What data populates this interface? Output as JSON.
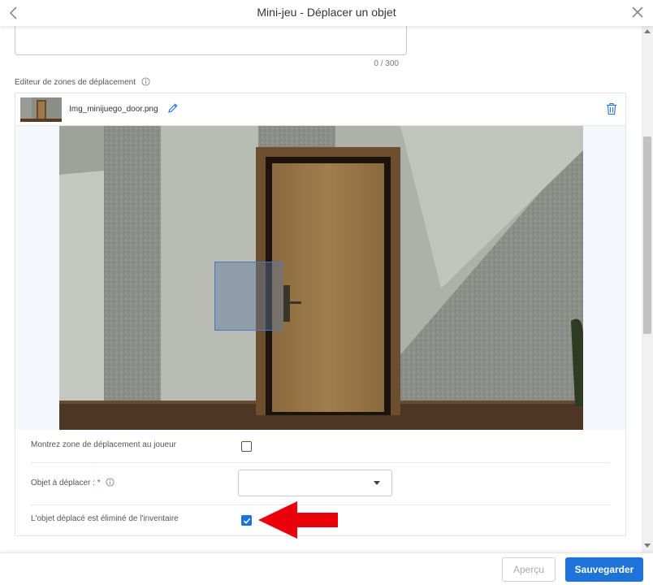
{
  "header": {
    "title": "Mini-jeu - Déplacer un objet",
    "back_icon": "chevron-left-icon",
    "close_icon": "close-icon"
  },
  "description": {
    "char_count": "0 / 300"
  },
  "editor": {
    "label": "Editeur de zones de déplacement",
    "file_name": "Img_minijuego_door.png",
    "edit_icon": "pencil-icon",
    "delete_icon": "trash-icon"
  },
  "options": {
    "show_zone_label": "Montrez zone de déplacement au joueur",
    "show_zone_checked": false,
    "object_label": "Objet à déplacer :",
    "object_required_mark": "*",
    "object_value": "",
    "remove_from_inventory_label": "L'objet déplacé est éliminé de l'inventaire",
    "remove_from_inventory_checked": true
  },
  "footer": {
    "preview_label": "Aperçu",
    "save_label": "Sauvegarder"
  },
  "colors": {
    "accent": "#1e73d8",
    "annotation_arrow": "#e8000b"
  }
}
